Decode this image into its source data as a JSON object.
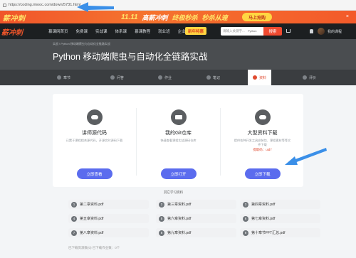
{
  "browser": {
    "url": "https://coding.imooc.com/down/5731.html"
  },
  "promo": {
    "left_text": "薪冲刺",
    "day": "11.11",
    "text1": "高薪冲刺",
    "text2": "终极秒杀",
    "text3": "秒杀从速",
    "button": "马上抢购",
    "close": "×"
  },
  "nav": {
    "logo": "薪冲刺",
    "items": [
      "慕课网首页",
      "免费课",
      "实战课",
      "体系课",
      "慕课教程",
      "就业班",
      "企业服务"
    ],
    "badge": "新年特惠",
    "search_placeholder": "请输入关键字...",
    "search_tag": "Python",
    "search_button": "搜索",
    "my_course": "我的课程"
  },
  "course": {
    "breadcrumb": "实战 \\ Python 移动端爬虫与自动化全链路实战",
    "title": "Python 移动端爬虫与自动化全链路实战"
  },
  "tabs": [
    {
      "label": "章节"
    },
    {
      "label": "问答"
    },
    {
      "label": "作业"
    },
    {
      "label": "笔记"
    },
    {
      "label": "资料"
    },
    {
      "label": "评价"
    }
  ],
  "resources": [
    {
      "title": "讲师源代码",
      "desc": "已置于课程相关源代码，开源实时源码下载",
      "code": "",
      "button": "立即查看"
    },
    {
      "title": "我的Git仓库",
      "desc": "快速查看课程实战源码仓库",
      "code": "",
      "button": "立即打开"
    },
    {
      "title": "大型资料下载",
      "desc": "提供各种开发工具安装包、课程素材等等文件下载",
      "code": "提取码：uid7",
      "button": "立即下载"
    }
  ],
  "files_title": "其它学习资料",
  "files": [
    {
      "num": "1",
      "name": "第二章资料.pdf"
    },
    {
      "num": "2",
      "name": "第三章资料.pdf"
    },
    {
      "num": "3",
      "name": "第四章资料.pdf"
    },
    {
      "num": "4",
      "name": "第五章资料.pdf"
    },
    {
      "num": "5",
      "name": "第六章资料.pdf"
    },
    {
      "num": "6",
      "name": "第七章资料.pdf"
    },
    {
      "num": "7",
      "name": "第八章资料.pdf"
    },
    {
      "num": "8",
      "name": "第九章资料.pdf"
    },
    {
      "num": "9",
      "name": "第十章节FFT汇总.pdf"
    }
  ],
  "footer_note": "已下载资源数(0)  已下载作业数：0个",
  "colors": {
    "accent": "#f04a30",
    "button": "#5b6cee",
    "arrow": "#3a8fe8"
  }
}
